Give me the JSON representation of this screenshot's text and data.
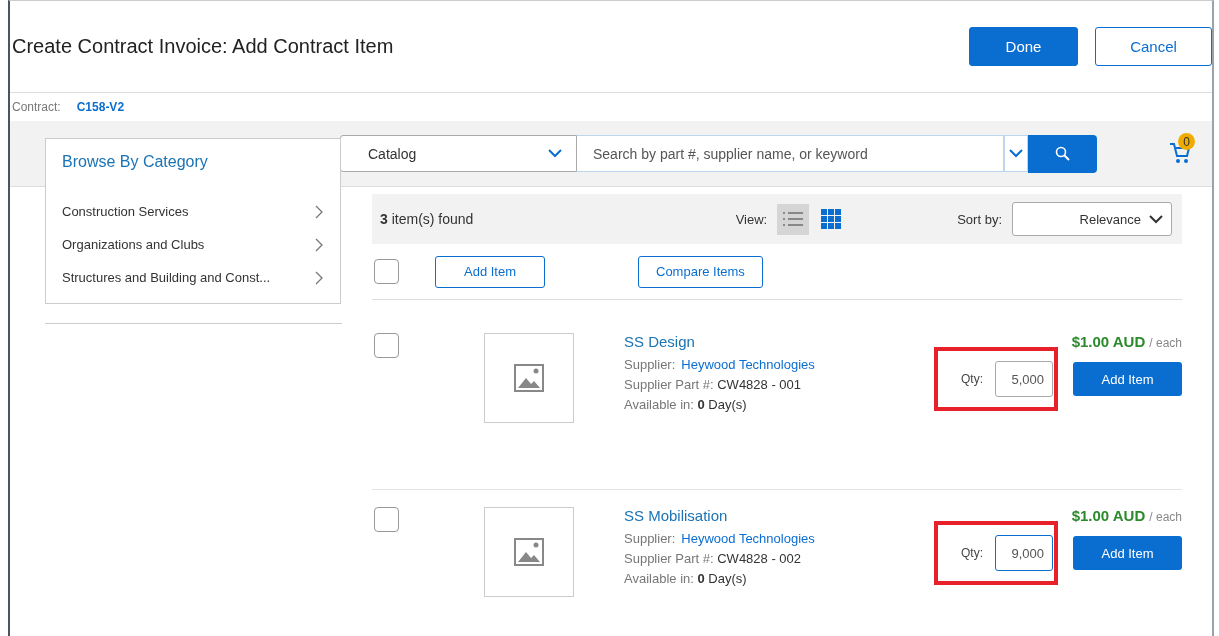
{
  "header": {
    "title": "Create Contract Invoice: Add Contract Item",
    "buttons": [
      {
        "label": "Done",
        "kind": "primary"
      },
      {
        "label": "Cancel",
        "kind": "secondary"
      }
    ]
  },
  "contract": {
    "label": "Contract:",
    "value": "C158-V2"
  },
  "category_panel": {
    "title": "Browse By Category",
    "items": [
      {
        "label": "Construction Services"
      },
      {
        "label": "Organizations and Clubs"
      },
      {
        "label": "Structures and Building and Const..."
      }
    ]
  },
  "search": {
    "scope": "Catalog",
    "placeholder": "Search by part #, supplier name, or keyword"
  },
  "cart": {
    "count": "0"
  },
  "results": {
    "count": "3",
    "count_label": "item(s) found",
    "view_label": "View:",
    "views": [
      {
        "kind": "list",
        "selected": true
      },
      {
        "kind": "grid",
        "selected": false
      }
    ],
    "sort_label": "Sort by:",
    "sort_value": "Relevance",
    "select_all_checked": false,
    "actions": [
      "Add Item",
      "Compare Items"
    ]
  },
  "items": [
    {
      "name": "SS Design",
      "supplier_label": "Supplier:",
      "supplier": "Heywood Technologies",
      "part_label": "Supplier Part #:",
      "part": "CW4828 - 001",
      "available_label": "Available in:",
      "available_days": "0",
      "available_unit": "Day(s)",
      "price": "$1.00 AUD",
      "unit": "/ each",
      "qty_label": "Qty:",
      "qty": "5,000",
      "focused": false,
      "checked": false,
      "highlighted": true,
      "add_label": "Add Item"
    },
    {
      "name": "SS Mobilisation",
      "supplier_label": "Supplier:",
      "supplier": "Heywood Technologies",
      "part_label": "Supplier Part #:",
      "part": "CW4828 - 002",
      "available_label": "Available in:",
      "available_days": "0",
      "available_unit": "Day(s)",
      "price": "$1.00 AUD",
      "unit": "/ each",
      "qty_label": "Qty:",
      "qty": "9,000",
      "focused": true,
      "checked": false,
      "highlighted": true,
      "add_label": "Add Item"
    }
  ]
}
